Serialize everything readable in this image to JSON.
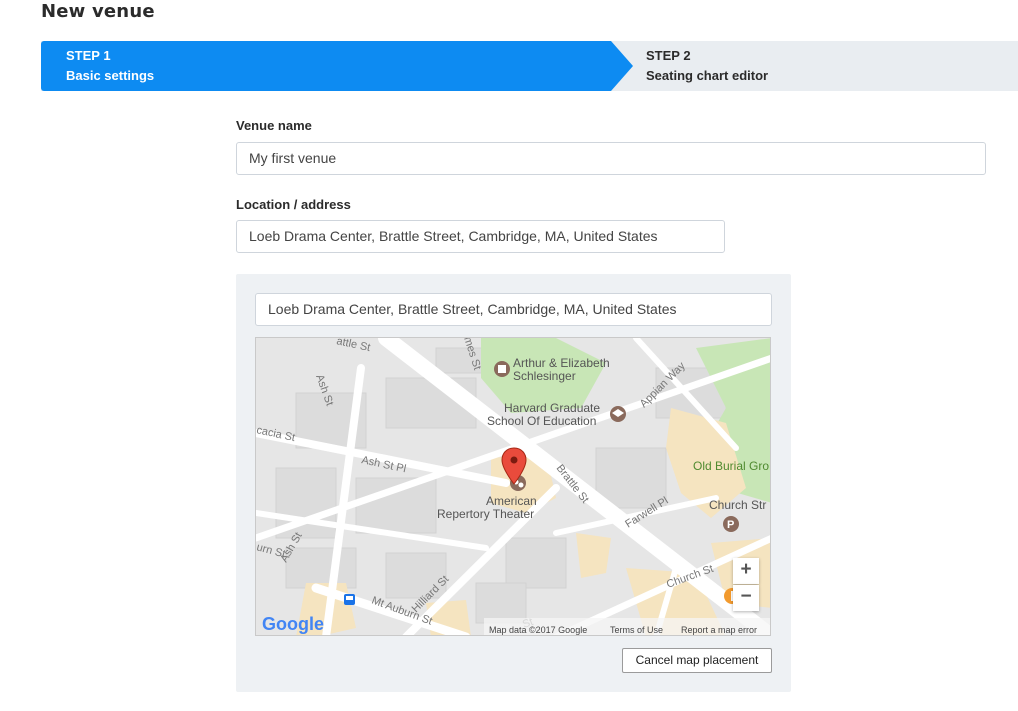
{
  "page": {
    "title": "New venue"
  },
  "wizard": {
    "steps": [
      {
        "number": "STEP 1",
        "label": "Basic settings",
        "active": true
      },
      {
        "number": "STEP 2",
        "label": "Seating chart editor",
        "active": false
      }
    ],
    "active_color": "#0d8bf2"
  },
  "form": {
    "venue_name": {
      "label": "Venue name",
      "value": "My first venue"
    },
    "location": {
      "label": "Location / address",
      "value": "Loeb Drama Center, Brattle Street, Cambridge, MA, United States"
    }
  },
  "map": {
    "search_value": "Loeb Drama Center, Brattle Street, Cambridge, MA, United States",
    "labels": {
      "schlesinger_1": "Arthur & Elizabeth",
      "schlesinger_2": "Schlesinger",
      "harvard_1": "Harvard Graduate",
      "harvard_2": "School Of Education",
      "theater_1": "American",
      "theater_2": "Repertory Theater",
      "burial": "Old Burial Gro",
      "church_str": "Church Str",
      "appian": "Appian Way",
      "brattle": "Brattle St",
      "farwell": "Farwell Pl",
      "church_st": "Church St",
      "ash_st_pl": "Ash St Pl",
      "ash_st": "Ash St",
      "ash_st_2": "Ash St",
      "acacia": "cacia St",
      "hilliard": "Hilliard St",
      "mt_auburn": "Mt Auburn St",
      "james_st": "mes St",
      "top_st": "attle St",
      "auburn": "urn St",
      "bottom_st": "St",
      "google": "Google",
      "map_data": "Map data ©2017 Google",
      "terms": "Terms of Use",
      "report": "Report a map error"
    },
    "zoom_in": "+",
    "zoom_out": "−",
    "icons": [
      "library-icon",
      "school-icon",
      "theater-icon",
      "parking-icon",
      "restaurant-icon",
      "bus-stop-icon",
      "map-pin-icon"
    ]
  },
  "buttons": {
    "cancel_map": "Cancel map placement"
  }
}
